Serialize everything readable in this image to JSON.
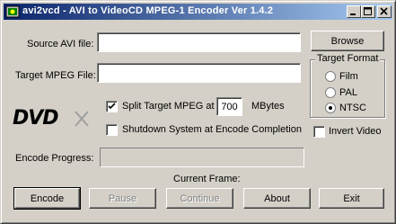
{
  "window": {
    "title": "avi2vcd - AVI to VideoCD MPEG-1 Encoder Ver 1.4.2"
  },
  "title_buttons": [
    "minimize",
    "maximize",
    "close"
  ],
  "source": {
    "label": "Source AVI file:",
    "value": "",
    "browse_label": "Browse"
  },
  "target": {
    "label": "Target MPEG File:",
    "value": ""
  },
  "split": {
    "label": "Split Target MPEG at",
    "checked": true,
    "size_value": "700",
    "unit": "MBytes"
  },
  "shutdown": {
    "label": "Shutdown System at Encode Completion",
    "checked": false
  },
  "logo": {
    "text": "DVD"
  },
  "target_format": {
    "title": "Target Format",
    "options": [
      {
        "label": "Film",
        "selected": false
      },
      {
        "label": "PAL",
        "selected": false
      },
      {
        "label": "NTSC",
        "selected": true
      }
    ]
  },
  "invert_video": {
    "label": "Invert Video",
    "checked": false
  },
  "progress": {
    "label": "Encode Progress:",
    "fraction": 0
  },
  "current_frame": {
    "label": "Current Frame:"
  },
  "buttons": {
    "encode": "Encode",
    "pause": "Pause",
    "continue": "Continue",
    "about": "About",
    "exit": "Exit"
  },
  "colors": {
    "titlebar_start": "#0a246a",
    "titlebar_end": "#a6caf0",
    "face": "#d4d0c8"
  }
}
